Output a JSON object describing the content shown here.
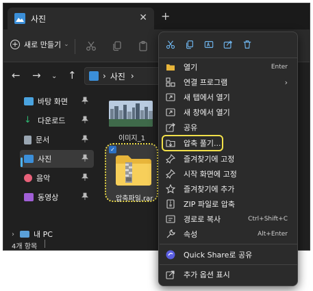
{
  "window": {
    "tab_title": "사진",
    "new_tab_label": "+",
    "close_label": "✕"
  },
  "toolbar": {
    "new_label": "새로 만들기"
  },
  "address": {
    "path_segment": "사진",
    "path_chevron": "›"
  },
  "sidebar": {
    "items": [
      {
        "label": "바탕 화면",
        "icon": "desktop-icon",
        "color": "#4aa3df"
      },
      {
        "label": "다운로드",
        "icon": "download-icon",
        "color": "#2fb872"
      },
      {
        "label": "문서",
        "icon": "document-icon",
        "color": "#9aa6b2"
      },
      {
        "label": "사진",
        "icon": "pictures-icon",
        "color": "#3b8fd9"
      },
      {
        "label": "음악",
        "icon": "music-icon",
        "color": "#e8617a"
      },
      {
        "label": "동영상",
        "icon": "video-icon",
        "color": "#a05fd6"
      }
    ],
    "pc_label": "내 PC"
  },
  "files": [
    {
      "name": "이미지_1",
      "type": "image"
    },
    {
      "name": "압축파일.rar",
      "type": "zip"
    }
  ],
  "status": {
    "count": "4개 항목"
  },
  "context_menu": {
    "items": [
      {
        "label": "열기",
        "shortcut": "Enter"
      },
      {
        "label": "연결 프로그램",
        "arrow": "›"
      },
      {
        "label": "새 탭에서 열기"
      },
      {
        "label": "새 창에서 열기"
      },
      {
        "label": "공유"
      },
      {
        "label": "압축 풀기..."
      },
      {
        "label": "즐겨찾기에 고정"
      },
      {
        "label": "시작 화면에 고정"
      },
      {
        "label": "즐겨찾기에 추가"
      },
      {
        "label": "ZIP 파일로 압축"
      },
      {
        "label": "경로로 복사",
        "shortcut": "Ctrl+Shift+C"
      },
      {
        "label": "속성",
        "shortcut": "Alt+Enter"
      },
      {
        "label": "Quick Share로 공유"
      },
      {
        "label": "추가 옵션 표시"
      }
    ]
  },
  "colors": {
    "highlight": "#f2e14a",
    "accent": "#3b8fd9",
    "background": "#202020",
    "menu_background": "#2b2b2b"
  }
}
